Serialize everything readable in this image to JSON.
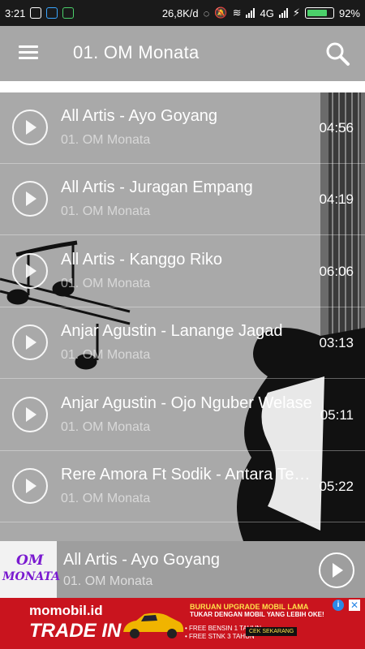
{
  "status_bar": {
    "time": "3:21",
    "speed": "26,8K/d",
    "network": "4G",
    "battery": "92%",
    "battery_level": 92
  },
  "toolbar": {
    "title": "01. OM Monata",
    "menu_icon": "hamburger-menu-icon",
    "search_icon": "search-icon"
  },
  "songs": [
    {
      "title": "All Artis - Ayo Goyang",
      "album": "01. OM Monata",
      "duration": "04:56"
    },
    {
      "title": "All Artis - Juragan Empang",
      "album": "01. OM Monata",
      "duration": "04:19"
    },
    {
      "title": "All Artis - Kanggo Riko",
      "album": "01. OM Monata",
      "duration": "06:06"
    },
    {
      "title": "Anjar Agustin - Lanange Jagad",
      "album": "01. OM Monata",
      "duration": "03:13"
    },
    {
      "title": "Anjar Agustin - Ojo Nguber Welase",
      "album": "01. OM Monata",
      "duration": "05:11"
    },
    {
      "title": "Rere Amora Ft Sodik - Antara Teman Dan Kasih",
      "album": "01. OM Monata",
      "duration": "05:22"
    }
  ],
  "now_playing": {
    "logo_text_1": "OM",
    "logo_text_2": "MONATA",
    "title": "All Artis - Ayo Goyang",
    "album": "01. OM Monata"
  },
  "ad": {
    "brand": "momobil.id",
    "headline": "TRADE IN",
    "line1": "BURUAN UPGRADE MOBIL LAMA",
    "line2": "TUKAR DENGAN MOBIL YANG LEBIH OKE!",
    "line3": "• FREE BENSIN 1 TAHUN",
    "line4": "• FREE STNK 3 TAHUN",
    "cta": "CEK SEKARANG",
    "info": "i",
    "close": "✕"
  },
  "colors": {
    "status_bg": "#1a1a1a",
    "toolbar_bg": "#a7a7a7",
    "list_bg": "#a9a9a9",
    "ad_bg": "#c9141e"
  }
}
